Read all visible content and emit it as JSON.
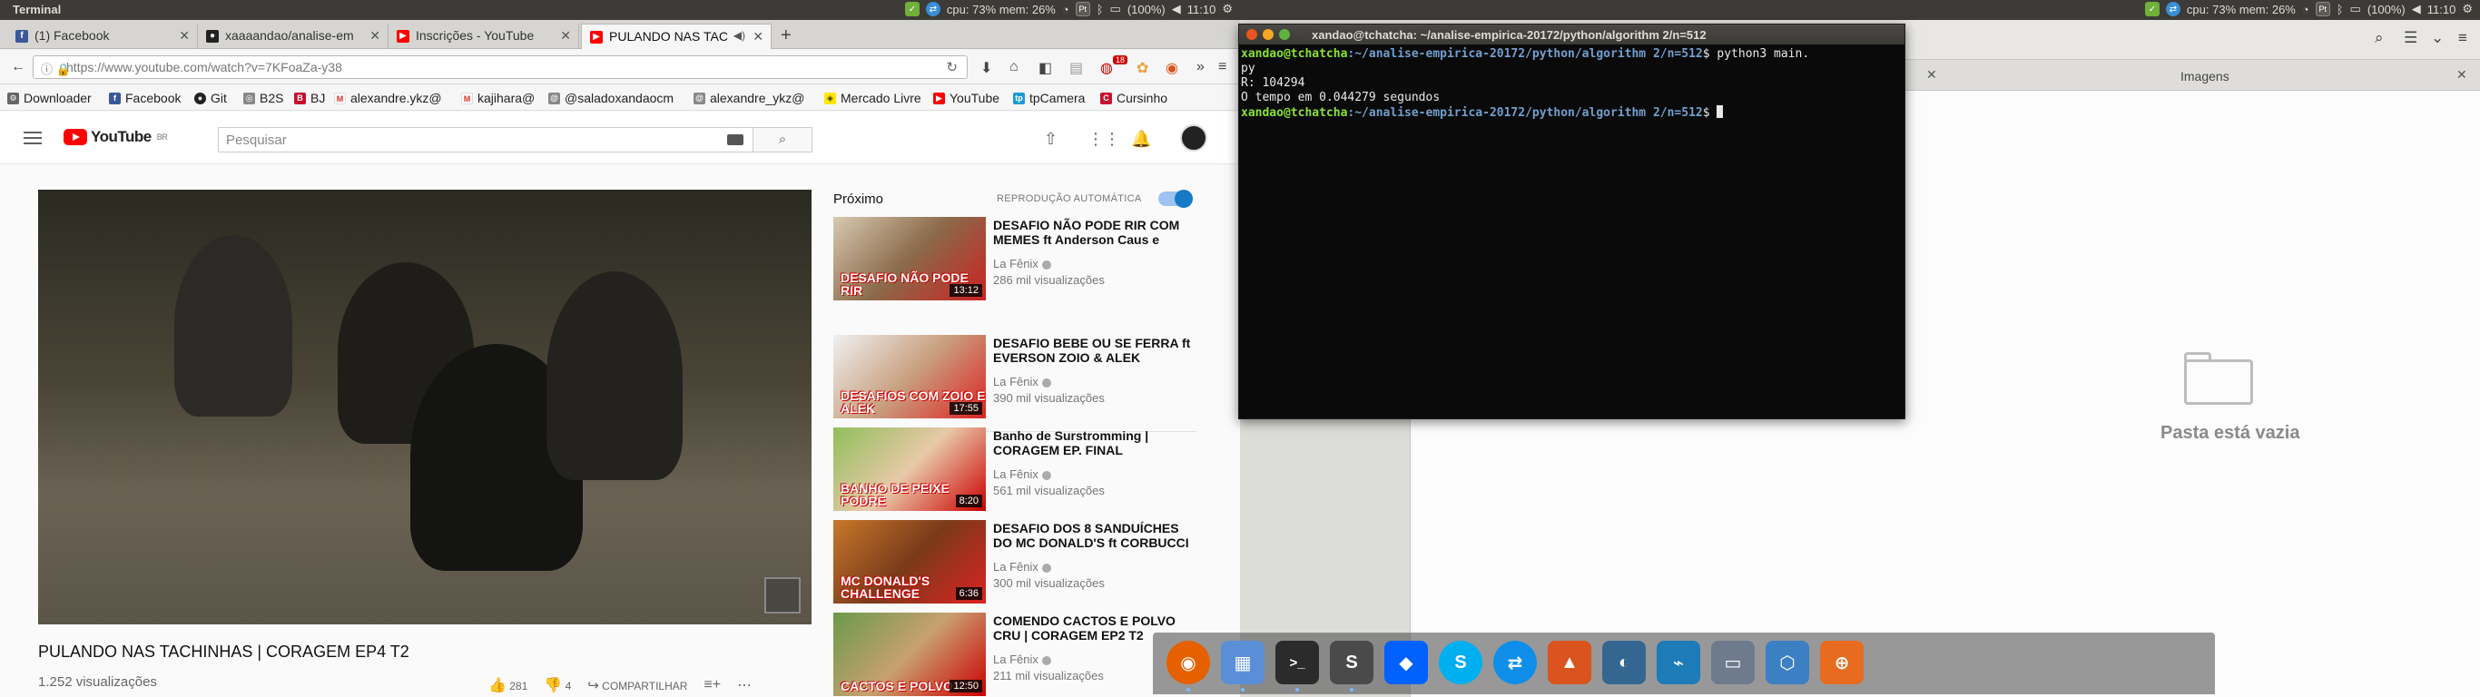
{
  "panel": {
    "title": "Terminal",
    "cpu": "cpu: 73% mem: 26%",
    "battery": "(100%)",
    "time": "11:10",
    "keyboard": "Pt"
  },
  "browser": {
    "tabs": [
      {
        "label": "(1) Facebook",
        "icon": "facebook-icon",
        "color": "#3b5998"
      },
      {
        "label": "xaaaandao/analise-em",
        "icon": "github-icon",
        "color": "#222222"
      },
      {
        "label": "Inscrições - YouTube",
        "icon": "youtube-icon",
        "color": "#ff0000"
      },
      {
        "label": "PULANDO NAS TAC",
        "icon": "youtube-icon",
        "color": "#ff0000",
        "active": true
      }
    ],
    "url": "https://www.youtube.com/watch?v=7KFoaZa-y38",
    "notification_badge": "18",
    "bookmarks": [
      {
        "label": "Downloader",
        "color": "#666666"
      },
      {
        "label": "Facebook",
        "color": "#3b5998"
      },
      {
        "label": "Git",
        "color": "#222222"
      },
      {
        "label": "B2S",
        "color": "#888888"
      },
      {
        "label": "BJ",
        "color": "#c8102e"
      },
      {
        "label": "alexandre.ykz@",
        "color": "#d93025"
      },
      {
        "label": "kajihara@",
        "color": "#d93025"
      },
      {
        "label": "@saladoxandaocm",
        "color": "#888888"
      },
      {
        "label": "alexandre_ykz@",
        "color": "#888888"
      },
      {
        "label": "Mercado Livre",
        "color": "#ffe600"
      },
      {
        "label": "YouTube",
        "color": "#ff0000"
      },
      {
        "label": "tpCamera",
        "color": "#1a9ad6"
      },
      {
        "label": "Cursinho",
        "color": "#c8102e"
      }
    ]
  },
  "youtube": {
    "logo": "YouTube",
    "logo_region": "BR",
    "search_placeholder": "Pesquisar",
    "video_title": "PULANDO NAS TACHINHAS | CORAGEM EP4 T2",
    "video_views": "1.252 visualizações",
    "likes": "281",
    "dislikes": "4",
    "share": "COMPARTILHAR",
    "next_label": "Próximo",
    "autoplay_label": "REPRODUÇÃO AUTOMÁTICA",
    "autoplay_on": true,
    "recommendations": [
      {
        "title": "DESAFIO NÃO PODE RIR COM MEMES ft Anderson Caus e",
        "channel": "La Fênix",
        "views": "286 mil visualizações",
        "duration": "13:12",
        "thumb_text": "DESAFIO NÃO PODE RIR"
      },
      {
        "title": "DESAFIO BEBE OU SE FERRA ft EVERSON ZOIO & ALEK",
        "channel": "La Fênix",
        "views": "390 mil visualizações",
        "duration": "17:55",
        "thumb_text": "DESAFIOS COM ZOIO E ALEK"
      },
      {
        "title": "Banho de Surstromming | CORAGEM EP. FINAL",
        "channel": "La Fênix",
        "views": "561 mil visualizações",
        "duration": "8:20",
        "thumb_text": "BANHO DE PEIXE PODRE"
      },
      {
        "title": "DESAFIO DOS 8 SANDUÍCHES DO MC DONALD'S ft CORBUCCI",
        "channel": "La Fênix",
        "views": "300 mil visualizações",
        "duration": "6:36",
        "thumb_text": "MC DONALD'S CHALLENGE"
      },
      {
        "title": "COMENDO CACTOS E POLVO CRU | CORAGEM EP2 T2",
        "channel": "La Fênix",
        "views": "211 mil visualizações",
        "duration": "12:50",
        "thumb_text": "CACTOS E POLVO"
      }
    ]
  },
  "terminal": {
    "title": "xandao@tchatcha: ~/analise-empirica-20172/python/algorithm 2/n=512",
    "user_host": "xandao@tchatcha",
    "path": ":~/analise-empirica-20172/python/algorithm 2/n=512",
    "prompt_symbol": "$ ",
    "command_1": "python3 main.",
    "command_1_wrap": "py",
    "output_1": "R: 104294",
    "output_2": "O tempo em 0.044279 segundos"
  },
  "files": {
    "tab_label": "Imagens",
    "empty_message": "Pasta está vazia"
  },
  "dock": [
    {
      "name": "firefox-icon",
      "color": "#e66000",
      "glyph": "◉"
    },
    {
      "name": "files-icon",
      "color": "#5a8fd8",
      "glyph": "▦"
    },
    {
      "name": "terminal-icon",
      "color": "#2b2b2b",
      "glyph": ">_"
    },
    {
      "name": "sublime-text-icon",
      "color": "#4a4a4a",
      "glyph": "S"
    },
    {
      "name": "dropbox-icon",
      "color": "#0061ff",
      "glyph": "◆"
    },
    {
      "name": "skype-icon",
      "color": "#00aff0",
      "glyph": "S"
    },
    {
      "name": "teamviewer-icon",
      "color": "#0e8ee9",
      "glyph": "⇄"
    },
    {
      "name": "matlab-icon",
      "color": "#d9541e",
      "glyph": "▲"
    },
    {
      "name": "postgresql-icon",
      "color": "#336791",
      "glyph": "◐"
    },
    {
      "name": "mysql-workbench-icon",
      "color": "#1d7bb8",
      "glyph": "⌁"
    },
    {
      "name": "remote-desktop-icon",
      "color": "#6d7b8d",
      "glyph": "▭"
    },
    {
      "name": "virtualbox-icon",
      "color": "#3c7fc2",
      "glyph": "⬡"
    },
    {
      "name": "diagram-app-icon",
      "color": "#e86b1f",
      "glyph": "⊕"
    }
  ]
}
